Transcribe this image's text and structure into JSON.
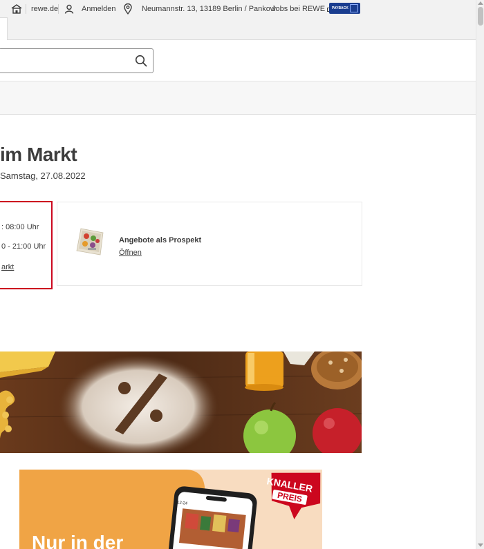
{
  "topbar": {
    "home_label": "rewe.de",
    "login_label": "Anmelden",
    "address": "Neumannstr. 13, 13189 Berlin / Pankow",
    "jobs_label": "Jobs bei REWE",
    "payback_label": "PAYBACK"
  },
  "page": {
    "title": "im Markt",
    "date_line": "Samstag, 27.08.2022"
  },
  "hours_card": {
    "line1": ": 08:00 Uhr",
    "line2": "0 - 21:00 Uhr",
    "link": "arkt"
  },
  "prospekt_card": {
    "title": "Angebote als Prospekt",
    "link": "Öffnen"
  },
  "promo": {
    "headline": "Nur in der",
    "badge_line1": "KNALLER",
    "badge_line2": "PREIS",
    "phone_time": "12:24"
  },
  "colors": {
    "accent_red": "#cc071e",
    "payback_blue": "#1a3d8f"
  },
  "icons": [
    "home-icon",
    "user-icon",
    "location-pin-icon",
    "external-link-icon",
    "search-icon"
  ]
}
